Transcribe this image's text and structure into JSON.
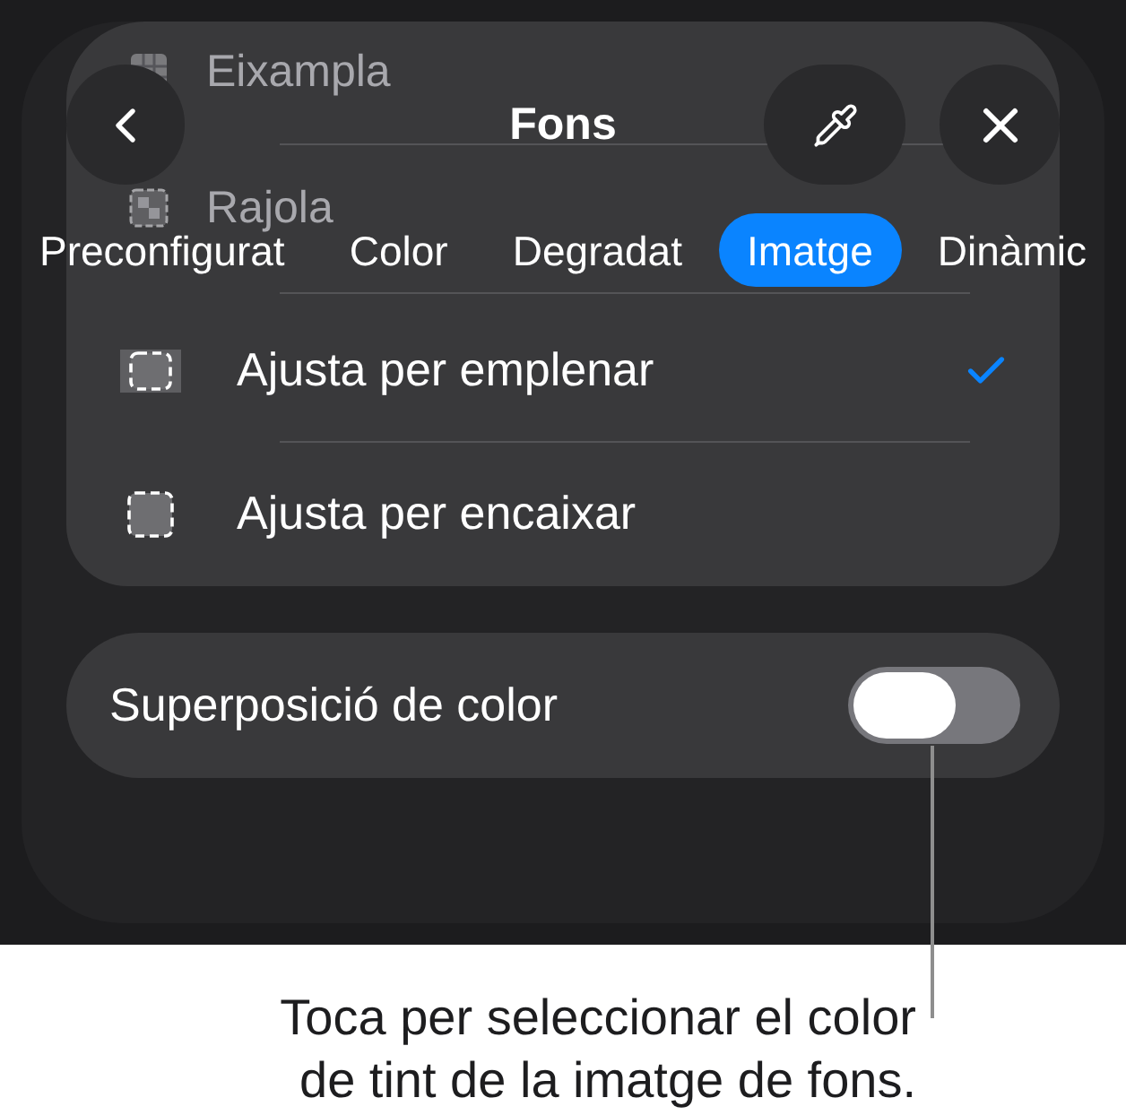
{
  "header": {
    "title": "Fons"
  },
  "scrolled_options": [
    {
      "label": "Eixampla",
      "kind": "stretch"
    },
    {
      "label": "Rajola",
      "kind": "tile"
    }
  ],
  "tabs": [
    {
      "label": "Preconfigurat",
      "selected": false
    },
    {
      "label": "Color",
      "selected": false
    },
    {
      "label": "Degradat",
      "selected": false
    },
    {
      "label": "Imatge",
      "selected": true
    },
    {
      "label": "Dinàmic",
      "selected": false
    }
  ],
  "fill_options": [
    {
      "label": "Ajusta per emplenar",
      "kind": "fill",
      "selected": true
    },
    {
      "label": "Ajusta per encaixar",
      "kind": "fit",
      "selected": false
    }
  ],
  "color_overlay": {
    "label": "Superposició de color",
    "on": false
  },
  "callout": {
    "text": "Toca per seleccionar el color\nde tint de la imatge de fons."
  }
}
